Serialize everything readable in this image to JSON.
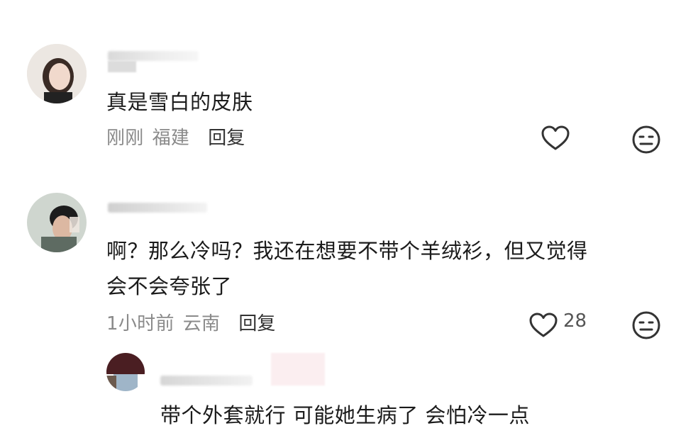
{
  "comments": [
    {
      "text": "真是雪白的皮肤",
      "time": "刚刚",
      "location": "福建",
      "reply_label": "回复",
      "like_count": ""
    },
    {
      "text_line1": "啊？那么冷吗？我还在想要不带个羊绒衫，但又觉得",
      "text_line2": "会不会夸张了",
      "time": "1小时前",
      "location": "云南",
      "reply_label": "回复",
      "like_count": "28"
    },
    {
      "text": "带个外套就行 可能她生病了 会怕冷一点"
    }
  ],
  "icons": {
    "like": "heart-icon",
    "dislike": "neutral-face-icon"
  },
  "colors": {
    "text": "#1b1b1b",
    "meta": "#8a8a8a",
    "icon_stroke": "#333333"
  }
}
